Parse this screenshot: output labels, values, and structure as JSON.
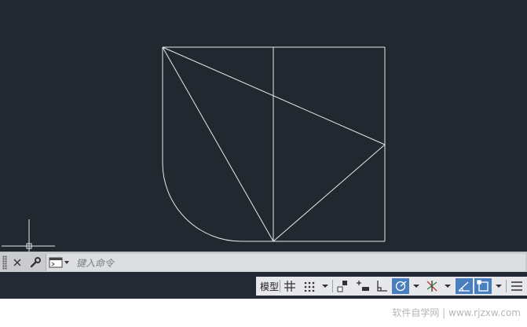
{
  "command_line": {
    "placeholder": "键入命令",
    "close_icon": "close-icon",
    "customize_icon": "wrench-icon",
    "recent_commands_icon": "command-history-icon"
  },
  "status_bar": {
    "model_label": "模型",
    "items": [
      {
        "name": "grid-icon",
        "active": false
      },
      {
        "name": "snap-mode-icon",
        "active": false
      },
      {
        "name": "snap-dropdown-icon",
        "active": false
      },
      {
        "name": "infer-constraints-icon",
        "active": false
      },
      {
        "name": "dynamic-input-icon",
        "active": false
      },
      {
        "name": "ortho-mode-icon",
        "active": false
      },
      {
        "name": "polar-tracking-icon",
        "active": true
      },
      {
        "name": "polar-dropdown-icon",
        "active": false
      },
      {
        "name": "isodraft-icon",
        "active": false
      },
      {
        "name": "isodraft-dropdown-icon",
        "active": false
      },
      {
        "name": "object-snap-tracking-icon",
        "active": true
      },
      {
        "name": "object-snap-icon",
        "active": true
      },
      {
        "name": "osnap-dropdown-icon",
        "active": false
      },
      {
        "name": "customize-menu-icon",
        "active": false
      }
    ],
    "accent_color": "#4a7fbf"
  },
  "watermark": {
    "text": "软件自学网 | www.rjzxw.com"
  },
  "colors": {
    "canvas_background": "#212830",
    "drawing_lines": "#e8eaed"
  }
}
